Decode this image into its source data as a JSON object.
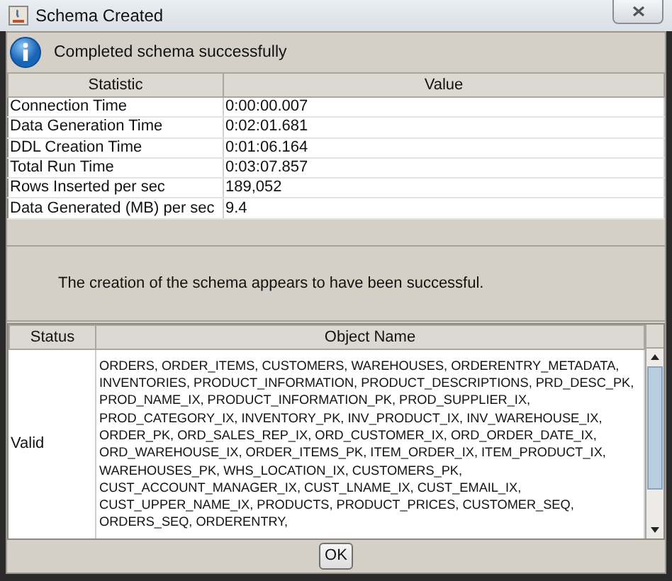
{
  "window": {
    "title": "Schema Created"
  },
  "message": "Completed schema successfully",
  "statistics": {
    "columns": [
      "Statistic",
      "Value"
    ],
    "rows": [
      {
        "statistic": "Connection Time",
        "value": "0:00:00.007"
      },
      {
        "statistic": "Data Generation Time",
        "value": "0:02:01.681"
      },
      {
        "statistic": "DDL Creation Time",
        "value": "0:01:06.164"
      },
      {
        "statistic": "Total Run Time",
        "value": "0:03:07.857"
      },
      {
        "statistic": "Rows Inserted per sec",
        "value": "189,052"
      },
      {
        "statistic": "Data Generated (MB) per sec",
        "value": "9.4"
      }
    ]
  },
  "summary": "The creation of the schema appears to have been successful.",
  "objects": {
    "columns": [
      "Status",
      "Object Name"
    ],
    "rows": [
      {
        "status": "Valid",
        "object_name": "ORDERS, ORDER_ITEMS, CUSTOMERS, WAREHOUSES, ORDERENTRY_METADATA,\nINVENTORIES, PRODUCT_INFORMATION, PRODUCT_DESCRIPTIONS, PRD_DESC_PK,\nPROD_NAME_IX, PRODUCT_INFORMATION_PK, PROD_SUPPLIER_IX,\nPROD_CATEGORY_IX, INVENTORY_PK, INV_PRODUCT_IX, INV_WAREHOUSE_IX,\nORDER_PK, ORD_SALES_REP_IX, ORD_CUSTOMER_IX, ORD_ORDER_DATE_IX,\nORD_WAREHOUSE_IX, ORDER_ITEMS_PK, ITEM_ORDER_IX, ITEM_PRODUCT_IX,\nWAREHOUSES_PK, WHS_LOCATION_IX, CUSTOMERS_PK,\nCUST_ACCOUNT_MANAGER_IX, CUST_LNAME_IX, CUST_EMAIL_IX,\nCUST_UPPER_NAME_IX, PRODUCTS, PRODUCT_PRICES, CUSTOMER_SEQ,\nORDERS_SEQ, ORDERENTRY,"
      }
    ]
  },
  "buttons": [
    "OK"
  ]
}
